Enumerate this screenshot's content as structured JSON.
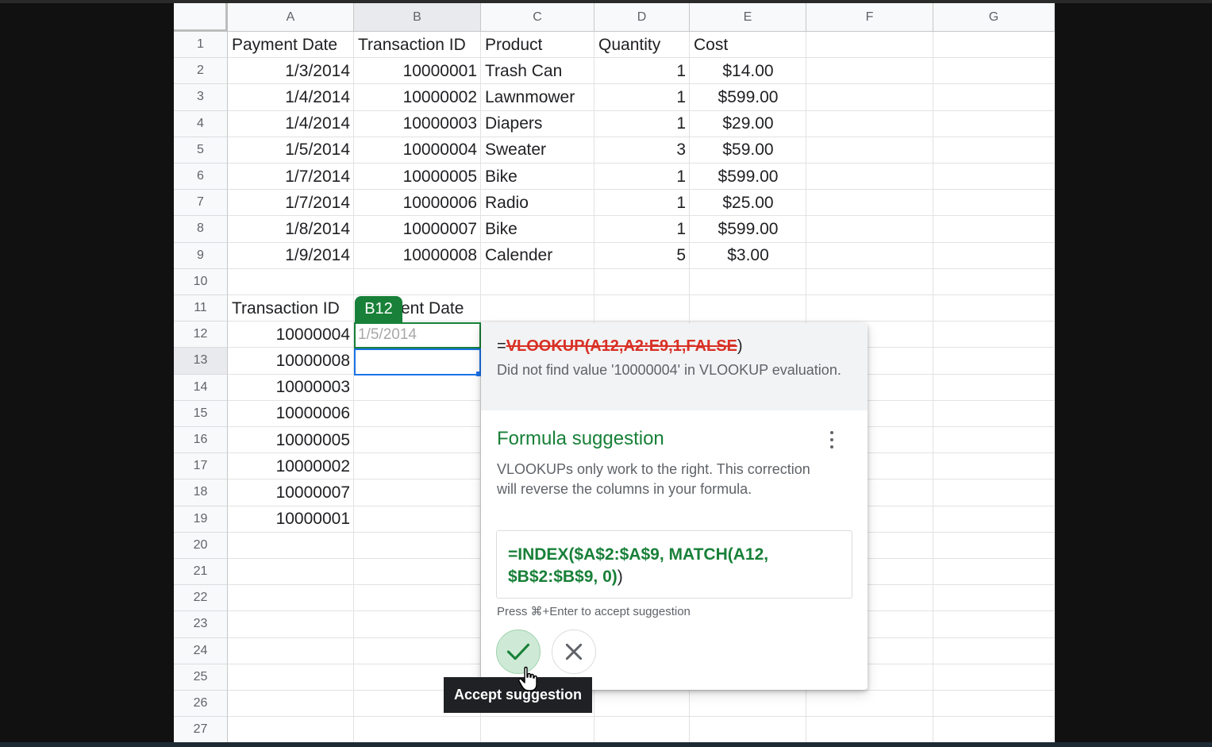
{
  "columns": [
    "A",
    "B",
    "C",
    "D",
    "E",
    "F",
    "G"
  ],
  "rows": [
    "1",
    "2",
    "3",
    "4",
    "5",
    "6",
    "7",
    "8",
    "9",
    "10",
    "11",
    "12",
    "13",
    "14",
    "15",
    "16",
    "17",
    "18",
    "19",
    "20",
    "21",
    "22",
    "23",
    "24",
    "25",
    "26",
    "27"
  ],
  "table": {
    "headers": [
      "Payment Date",
      "Transaction ID",
      "Product",
      "Quantity",
      "Cost"
    ],
    "rows": [
      [
        "1/3/2014",
        "10000001",
        "Trash Can",
        "1",
        "$14.00"
      ],
      [
        "1/4/2014",
        "10000002",
        "Lawnmower",
        "1",
        "$599.00"
      ],
      [
        "1/4/2014",
        "10000003",
        "Diapers",
        "1",
        "$29.00"
      ],
      [
        "1/5/2014",
        "10000004",
        "Sweater",
        "3",
        "$59.00"
      ],
      [
        "1/7/2014",
        "10000005",
        "Bike",
        "1",
        "$599.00"
      ],
      [
        "1/7/2014",
        "10000006",
        "Radio",
        "1",
        "$25.00"
      ],
      [
        "1/8/2014",
        "10000007",
        "Bike",
        "1",
        "$599.00"
      ],
      [
        "1/9/2014",
        "10000008",
        "Calender",
        "5",
        "$3.00"
      ]
    ]
  },
  "lookup": {
    "header_a": "Transaction ID",
    "header_b": "ent Date",
    "ids": [
      "10000004",
      "10000008",
      "10000003",
      "10000006",
      "10000005",
      "10000002",
      "10000007",
      "10000001"
    ],
    "b12_preview": "1/5/2014"
  },
  "cell_tag": "B12",
  "popup": {
    "error_prefix": "=",
    "error_formula": "VLOOKUP(A12,A2:E9,1,FALSE",
    "error_suffix": ")",
    "error_message": "Did not find value '10000004' in VLOOKUP evaluation.",
    "suggestion_title": "Formula suggestion",
    "suggestion_desc": "VLOOKUPs only work to the right. This correction will reverse the columns in your formula.",
    "suggested_formula": "=INDEX($A$2:$A$9, MATCH(A12, $B$2:$B$9, 0)",
    "suggested_suffix": ")",
    "hint": "Press ⌘+Enter to accept suggestion"
  },
  "tooltip": "Accept suggestion",
  "colors": {
    "accent_green": "#188038",
    "error_red": "#d93025",
    "selection_blue": "#1a73e8"
  }
}
